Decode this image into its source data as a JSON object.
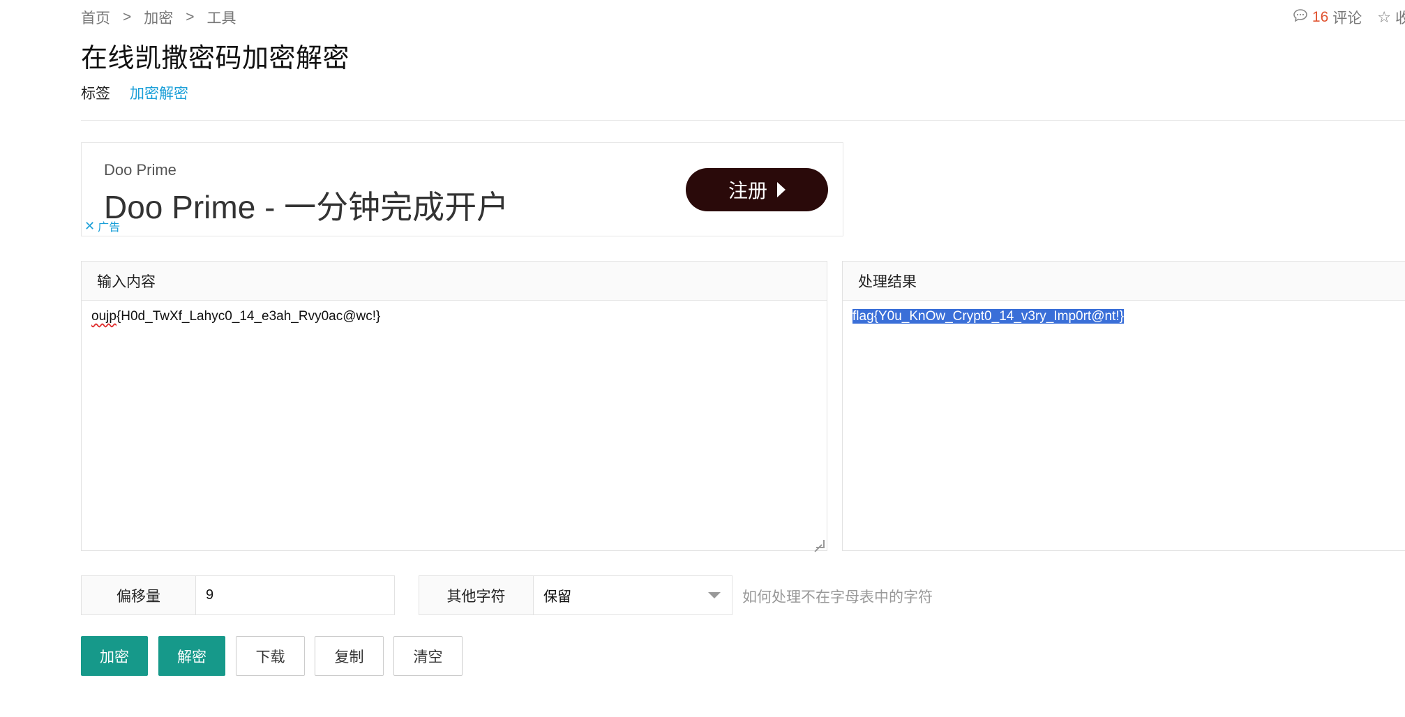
{
  "breadcrumb": {
    "items": [
      "首页",
      "加密",
      "工具"
    ],
    "separator": ">"
  },
  "header_actions": {
    "comment_count": "16",
    "comment_label": "评论",
    "favorite_label": "收藏"
  },
  "page": {
    "title": "在线凯撒密码加密解密"
  },
  "tags": {
    "label": "标签",
    "items": [
      "加密解密"
    ]
  },
  "ad": {
    "brand_small": "Doo Prime",
    "headline": "Doo Prime - 一分钟完成开户",
    "cta_label": "注册",
    "ad_label": "广告"
  },
  "input_panel": {
    "title": "输入内容",
    "text_misspelled": "oujp",
    "text_rest": "{H0d_TwXf_Lahyc0_14_e3ah_Rvy0ac@wc!}"
  },
  "output_panel": {
    "title": "处理结果",
    "text": "flag{Y0u_KnOw_Crypt0_14_v3ry_Imp0rt@nt!}"
  },
  "options": {
    "shift_label": "偏移量",
    "shift_value": "9",
    "other_chars_label": "其他字符",
    "other_chars_value": "保留",
    "hint": "如何处理不在字母表中的字符"
  },
  "buttons": {
    "encrypt": "加密",
    "decrypt": "解密",
    "download": "下载",
    "copy": "复制",
    "clear": "清空"
  },
  "colors": {
    "primary": "#16998a",
    "link": "#1a9fd8",
    "count": "#e0522f",
    "selection": "#3a6fd8",
    "cta_bg": "#2a0a0a"
  }
}
